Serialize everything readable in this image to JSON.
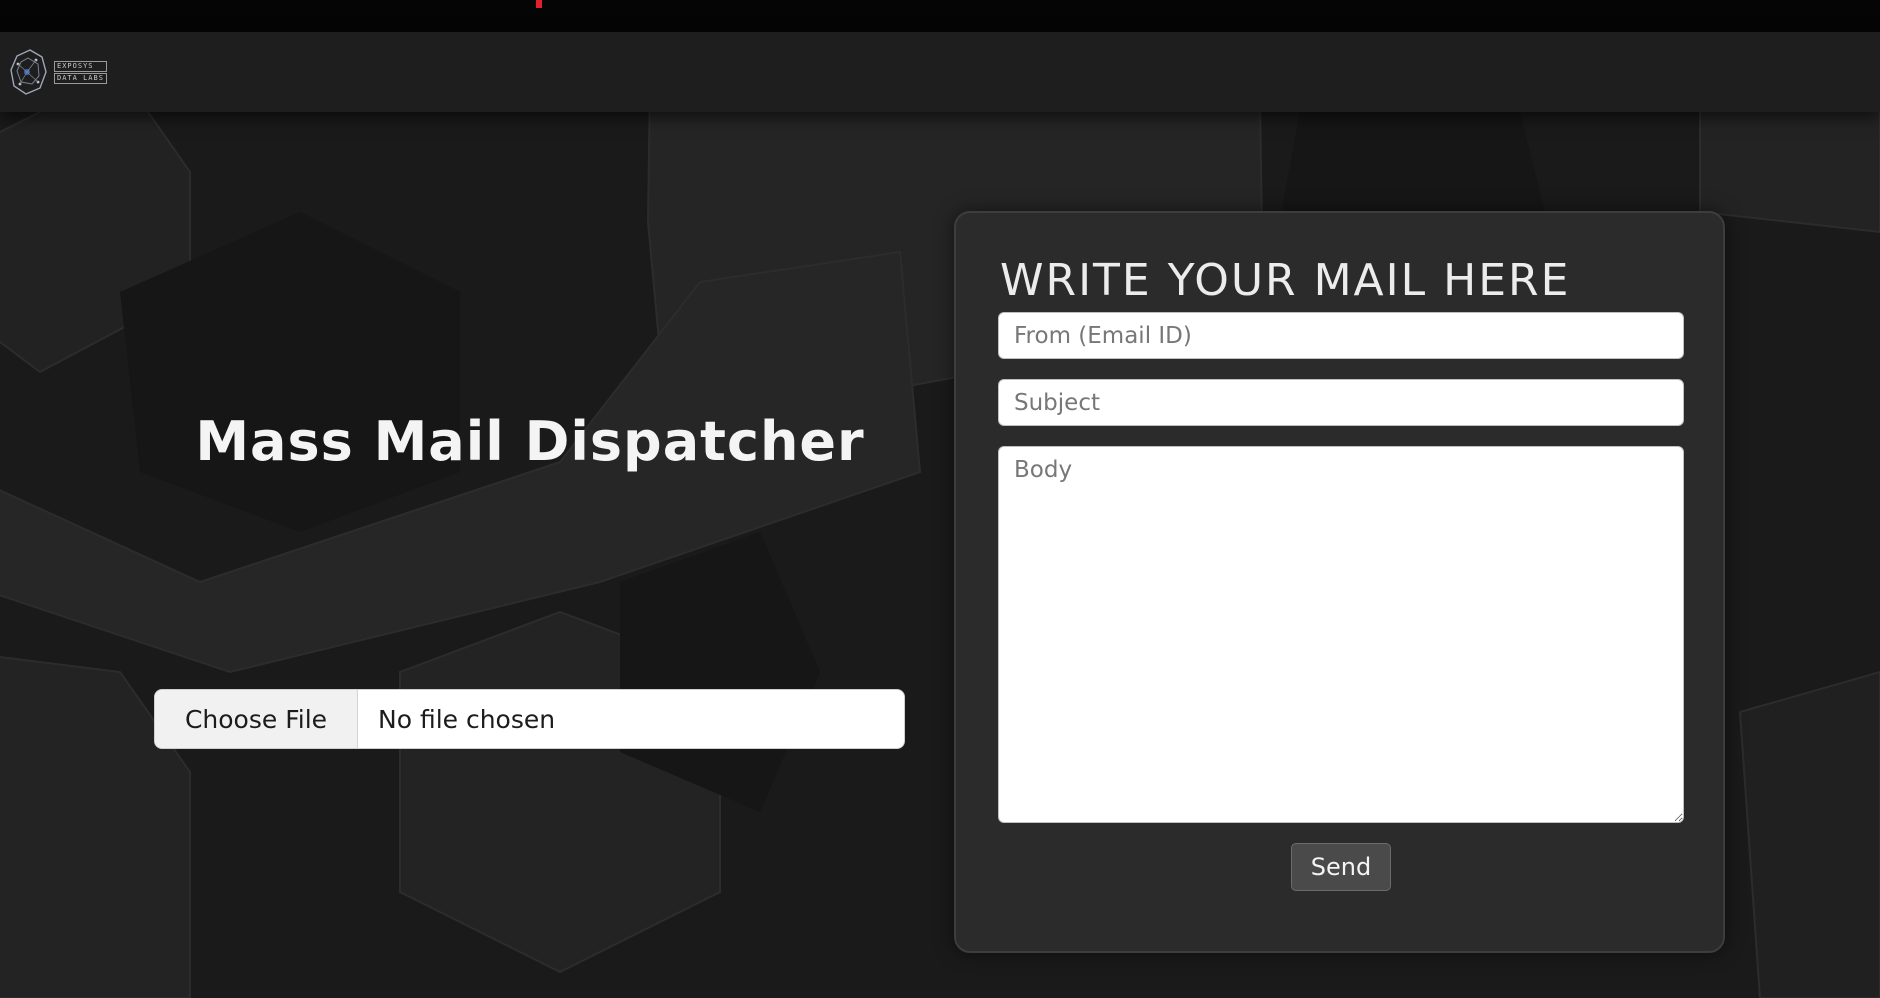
{
  "brand": {
    "logo_lines": [
      "EXPOSYS",
      "DATA LABS"
    ]
  },
  "hero": {
    "title": "Mass Mail Dispatcher"
  },
  "file_input": {
    "button_label": "Choose File",
    "status_text": "No file chosen"
  },
  "form": {
    "heading": "WRITE YOUR MAIL HERE",
    "from_placeholder": "From (Email ID)",
    "subject_placeholder": "Subject",
    "body_placeholder": "Body",
    "send_label": "Send"
  },
  "colors": {
    "background": "#1b1b1c",
    "card": "#2b2b2c",
    "accent": "#e0202a"
  }
}
